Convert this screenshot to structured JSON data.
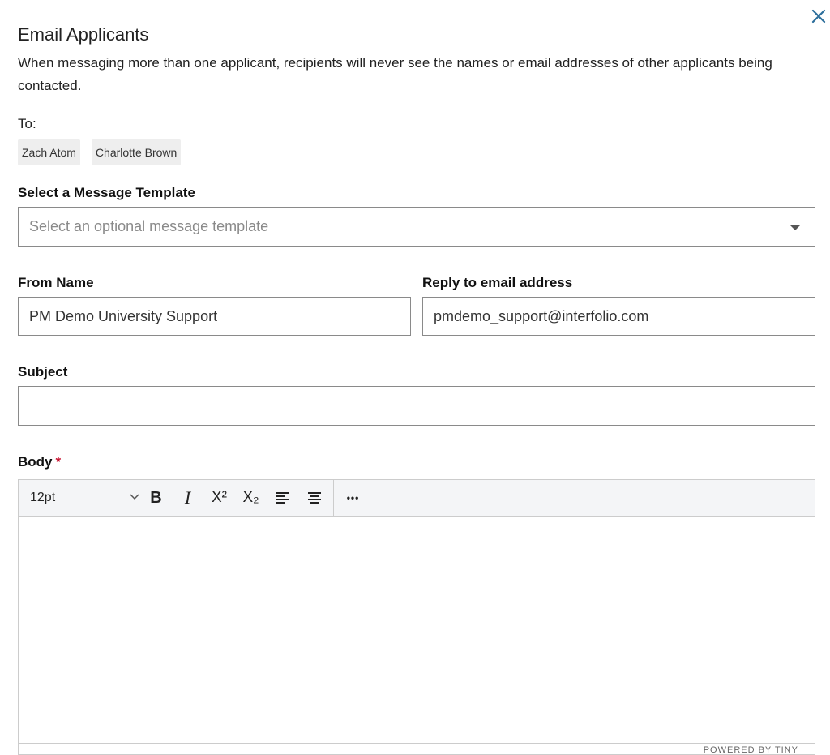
{
  "dialog": {
    "title": "Email Applicants",
    "description": "When messaging more than one applicant, recipients will never see the names or email addresses of other applicants being contacted."
  },
  "recipients": {
    "label": "To:",
    "items": [
      "Zach Atom",
      "Charlotte Brown"
    ]
  },
  "template": {
    "label": "Select a Message Template",
    "placeholder": "Select an optional message template"
  },
  "from_name": {
    "label": "From Name",
    "value": "PM Demo University Support"
  },
  "reply_to": {
    "label": "Reply to email address",
    "value": "pmdemo_support@interfolio.com"
  },
  "subject": {
    "label": "Subject",
    "value": ""
  },
  "body": {
    "label": "Body",
    "required_mark": "*",
    "toolbar": {
      "font_size": "12pt",
      "bold": "B",
      "italic": "I",
      "superscript": "X²",
      "subscript": "X₂",
      "more": "•••"
    },
    "footer_brand": "POWERED BY TINY"
  },
  "icons": [
    "close-icon",
    "dropdown-caret-icon",
    "chevron-down-icon",
    "bold-icon",
    "italic-icon",
    "superscript-icon",
    "subscript-icon",
    "align-left-icon",
    "align-center-icon",
    "more-icon"
  ],
  "colors": {
    "close_icon": "#2c6e9b",
    "required": "#c8102e",
    "chip_bg": "#eeeeee",
    "toolbar_bg": "#f4f5f7"
  }
}
